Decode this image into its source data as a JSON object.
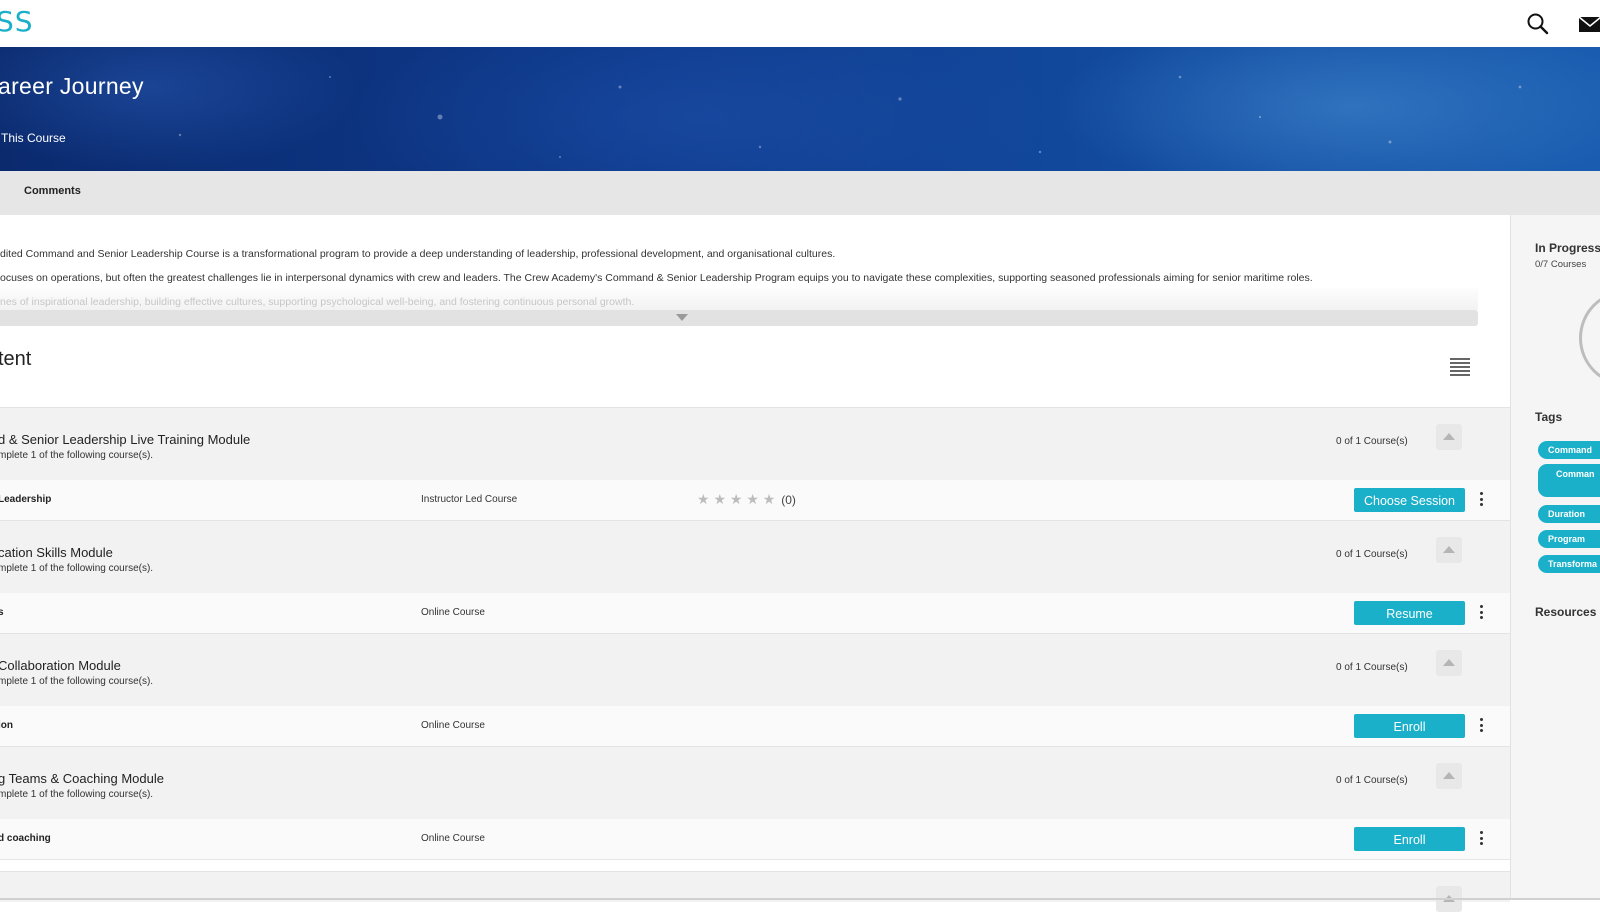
{
  "header": {
    "logo_text": "SS",
    "icons": [
      "search-icon",
      "mail-icon"
    ]
  },
  "hero": {
    "title": "areer Journey",
    "subtitle": "This Course"
  },
  "tabs": {
    "comments_label": "Comments"
  },
  "description": {
    "line1": "dited Command and Senior Leadership Course is a transformational program to provide a deep understanding of leadership, professional development, and organisational cultures.",
    "line2": "ocuses on operations, but often the greatest challenges lie in interpersonal dynamics with crew and leaders. The Crew Academy's Command & Senior Leadership Program equips you to navigate these complexities, supporting seasoned professionals aiming for senior maritime roles.",
    "line3": "nes of inspirational leadership, building effective cultures, supporting psychological well-being, and fostering continuous personal growth."
  },
  "content": {
    "heading": "tent",
    "modules": [
      {
        "title": "d & Senior Leadership Live Training Module",
        "desc": "mplete 1 of the following course(s).",
        "count": "0 of 1 Course(s)",
        "course": {
          "name": "Leadership",
          "type": "Instructor Led Course",
          "rating_stars": "★ ★ ★ ★ ★",
          "rating_count": "(0)",
          "action": "Choose Session"
        }
      },
      {
        "title": "cation Skills Module",
        "desc": "mplete 1 of the following course(s).",
        "count": "0 of 1 Course(s)",
        "course": {
          "name": "s",
          "type": "Online Course",
          "action": "Resume"
        }
      },
      {
        "title": "Collaboration Module",
        "desc": "mplete 1 of the following course(s).",
        "count": "0 of 1 Course(s)",
        "course": {
          "name": "ion",
          "type": "Online Course",
          "action": "Enroll"
        }
      },
      {
        "title": "g Teams & Coaching Module",
        "desc": "mplete 1 of the following course(s).",
        "count": "0 of 1 Course(s)",
        "course": {
          "name": "d coaching",
          "type": "Online Course",
          "action": "Enroll"
        }
      }
    ]
  },
  "sidebar": {
    "status": "In Progress",
    "courses_count": "0/7 Courses",
    "tags_heading": "Tags",
    "tags": [
      "Command",
      "Comman",
      "Duration",
      "Program",
      "Transforma"
    ],
    "resources_heading": "Resources"
  },
  "colors": {
    "accent": "#1bb0c9",
    "hero_dark": "#0b2a6e",
    "hero_light": "#1a5db0"
  }
}
